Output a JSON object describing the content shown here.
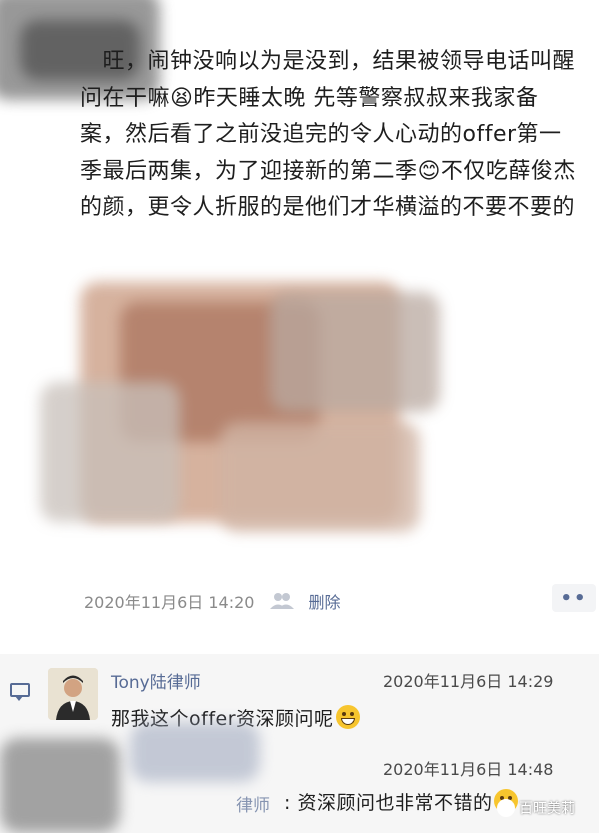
{
  "post": {
    "text": "   旺，闹钟没响以为是没到，结果被领导电话叫醒问在干嘛😫昨天睡太晚 先等警察叔叔来我家备案，然后看了之前没追完的令人心动的offer第一季最后两集，为了迎接新的第二季😊不仅吃薛俊杰的颜，更令人折服的是他们才华横溢的不要不要的",
    "time": "2020年11月6日 14:20",
    "delete_label": "删除",
    "more_label": "••"
  },
  "comments": [
    {
      "name": "Tony陆律师",
      "time": "2020年11月6日 14:29",
      "text": "那我这个offer资深顾问呢"
    },
    {
      "name": "律师",
      "time": "2020年11月6日 14:48",
      "text": ": 资深顾问也非常不错的"
    }
  ],
  "watermark": "百旺美莉",
  "icons": {
    "share": "friends-icon",
    "comment": "comment-icon",
    "emoji_grin": "grin-emoji-icon"
  },
  "colors": {
    "link": "#576b95",
    "meta": "#8a8a8a",
    "comment_bg": "#f6f6f6"
  }
}
